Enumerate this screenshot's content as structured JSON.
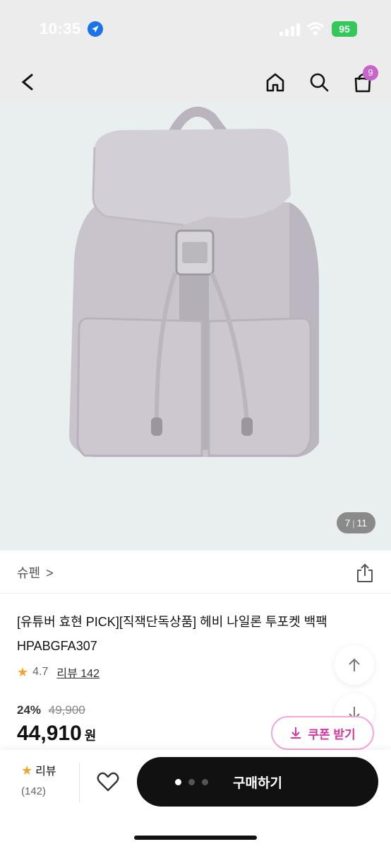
{
  "status_bar": {
    "time": "10:35",
    "battery": "95"
  },
  "nav": {
    "cart_count": "9"
  },
  "product_image": {
    "counter_current": "7",
    "counter_total": "11"
  },
  "brand": {
    "name": "슈펜",
    "chevron": ">"
  },
  "product": {
    "title": "[유튜버 효현 PICK][직잭단독상품] 헤비 나일론 투포켓 백팩 HPABGFA307",
    "rating": "4.7",
    "reviews_label": "리뷰 142",
    "discount": "24%",
    "original_price": "49,900",
    "price": "44,910",
    "currency": "원"
  },
  "coupon": {
    "label": "쿠폰 받기"
  },
  "bottom_bar": {
    "review_label": "리뷰",
    "review_count": "(142)",
    "buy_label": "구매하기"
  },
  "colors": {
    "accent_pink": "#d2389e",
    "badge_purple": "#c864cc",
    "star": "#f6a32a",
    "buy_button": "#111111"
  },
  "icons": [
    "location-arrow-icon",
    "signal-icon",
    "wifi-icon",
    "battery-icon",
    "back-icon",
    "home-icon",
    "search-icon",
    "cart-icon",
    "share-icon",
    "star-icon",
    "arrow-up-icon",
    "arrow-down-icon",
    "download-icon",
    "heart-icon"
  ]
}
